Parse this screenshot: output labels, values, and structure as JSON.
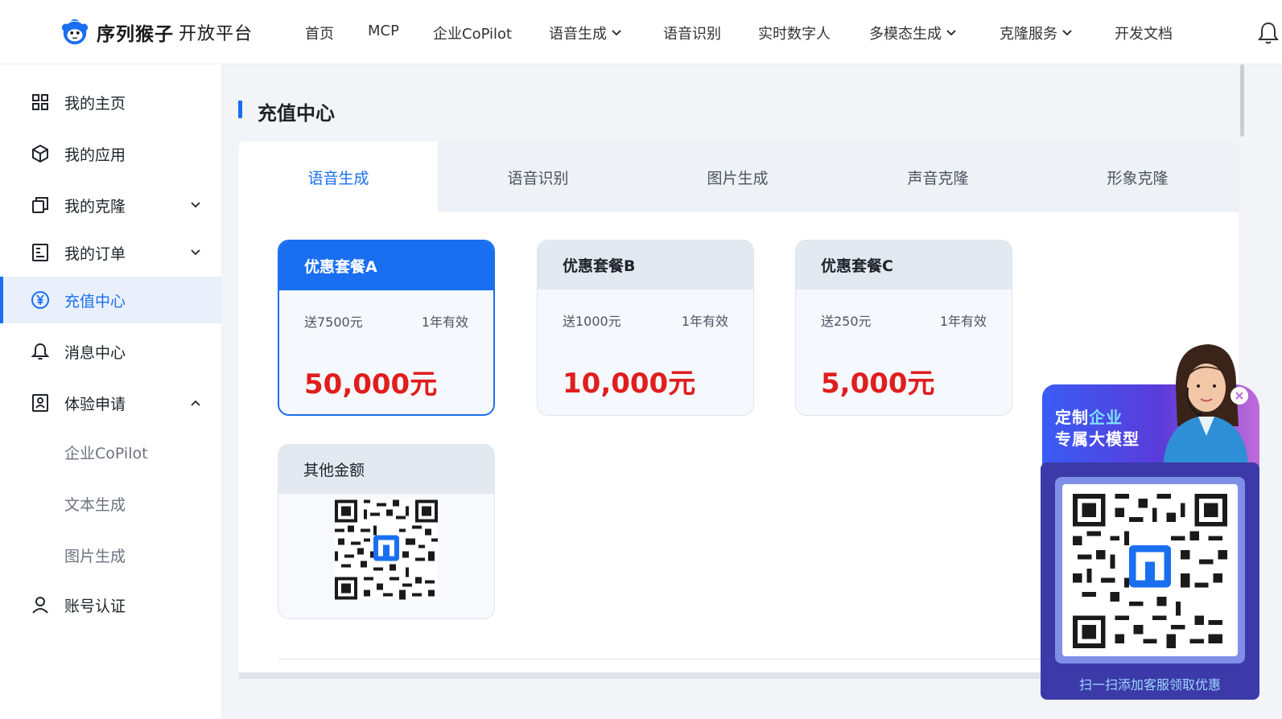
{
  "header": {
    "brand": "序列猴子",
    "brand_sub": "开放平台",
    "nav": [
      {
        "label": "首页",
        "has_dropdown": false
      },
      {
        "label": "MCP",
        "has_dropdown": false
      },
      {
        "label": "企业CoPilot",
        "has_dropdown": false
      },
      {
        "label": "语音生成",
        "has_dropdown": true
      },
      {
        "label": "语音识别",
        "has_dropdown": false
      },
      {
        "label": "实时数字人",
        "has_dropdown": false
      },
      {
        "label": "多模态生成",
        "has_dropdown": true
      },
      {
        "label": "克隆服务",
        "has_dropdown": true
      },
      {
        "label": "开发文档",
        "has_dropdown": false
      }
    ],
    "notification_icon": "bell-icon"
  },
  "sidebar": {
    "items": [
      {
        "label": "我的主页",
        "icon": "grid-icon",
        "expand": "none",
        "active": false
      },
      {
        "label": "我的应用",
        "icon": "cube-icon",
        "expand": "collapsed",
        "active": false
      },
      {
        "label": "我的克隆",
        "icon": "copy-icon",
        "expand": "collapsed",
        "active": false
      },
      {
        "label": "我的订单",
        "icon": "order-icon",
        "expand": "collapsed",
        "active": false
      },
      {
        "label": "充值中心",
        "icon": "yuan-icon",
        "expand": "none",
        "active": true
      },
      {
        "label": "消息中心",
        "icon": "bell-icon",
        "expand": "none",
        "active": false
      },
      {
        "label": "体验申请",
        "icon": "profile-icon",
        "expand": "expanded",
        "active": false
      },
      {
        "label": "账号认证",
        "icon": "user-icon",
        "expand": "none",
        "active": false
      }
    ],
    "sub_items": [
      "企业CoPilot",
      "文本生成",
      "图片生成"
    ]
  },
  "main": {
    "title": "充值中心",
    "tabs": [
      "语音生成",
      "语音识别",
      "图片生成",
      "声音克隆",
      "形象克隆"
    ],
    "active_tab": "语音生成",
    "packages": [
      {
        "name": "优惠套餐A",
        "bonus": "送7500元",
        "validity": "1年有效",
        "price": "50,000元",
        "selected": true
      },
      {
        "name": "优惠套餐B",
        "bonus": "送1000元",
        "validity": "1年有效",
        "price": "10,000元",
        "selected": false
      },
      {
        "name": "优惠套餐C",
        "bonus": "送250元",
        "validity": "1年有效",
        "price": "5,000元",
        "selected": false
      }
    ],
    "other_amount": {
      "name": "其他金额"
    }
  },
  "promo": {
    "line1_a": "定制",
    "line1_b": "企业",
    "line2": "专属大模型",
    "caption": "扫一扫添加客服领取优惠"
  },
  "colors": {
    "accent": "#1a6ff0",
    "price": "#e01e1e",
    "promo_bg": "#3b3aa8"
  }
}
